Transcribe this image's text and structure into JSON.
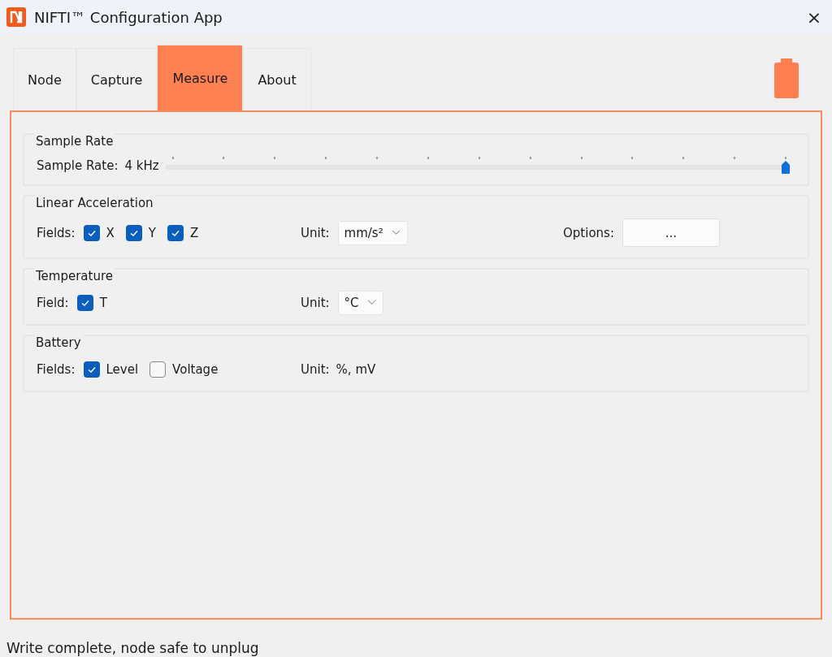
{
  "window": {
    "title": "NIFTI™ Configuration App",
    "close": "×"
  },
  "tabs": [
    {
      "label": "Node",
      "selected": false
    },
    {
      "label": "Capture",
      "selected": false
    },
    {
      "label": "Measure",
      "selected": true
    },
    {
      "label": "About",
      "selected": false
    }
  ],
  "groups": [
    {
      "kind": "slider",
      "title": "Sample Rate",
      "label": "Sample Rate:",
      "reading": "4 kHz",
      "level": 1
    },
    {
      "kind": "fields",
      "title": "Linear Acceleration",
      "label": "Fields:",
      "checkboxes": [
        {
          "label": "X",
          "checked": true
        },
        {
          "label": "Y",
          "checked": true
        },
        {
          "label": "Z",
          "checked": true
        }
      ],
      "unit": {
        "kind": "dropdown",
        "label": "Unit:",
        "value": "mm/s²"
      },
      "options": {
        "label": "Options:",
        "button": "..."
      }
    },
    {
      "kind": "fields",
      "title": "Temperature",
      "label": "Field:",
      "checkboxes": [
        {
          "label": "T",
          "checked": true
        }
      ],
      "unit": {
        "kind": "dropdown",
        "label": "Unit:",
        "value": "°C"
      }
    },
    {
      "kind": "fields",
      "title": "Battery",
      "label": "Fields:",
      "checkboxes": [
        {
          "label": "Level",
          "checked": true
        },
        {
          "label": "Voltage",
          "checked": false
        }
      ],
      "unit": {
        "kind": "text",
        "label": "Unit:",
        "value": "%, mV"
      }
    }
  ],
  "status_bar": "Write complete, node safe to unplug"
}
